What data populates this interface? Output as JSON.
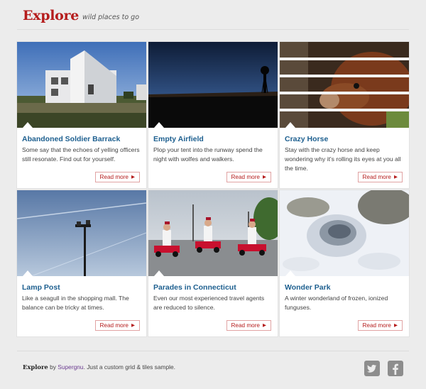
{
  "header": {
    "logo": "Explore",
    "tagline": "wild places to go"
  },
  "cards": [
    {
      "title": "Abandoned Soldier Barrack",
      "text": "Some say that the echoes of yelling officers still resonate. Find out for yourself.",
      "cta": "Read more"
    },
    {
      "title": "Empty Airfield",
      "text": "Plop your tent into the runway spend the night with wolfes and walkers.",
      "cta": "Read more"
    },
    {
      "title": "Crazy Horse",
      "text": "Stay with the crazy horse and keep wondering why it's rolling its eyes at you all the time.",
      "cta": "Read more"
    },
    {
      "title": "Lamp Post",
      "text": "Like a seagull in the shopping mall. The balance can be tricky at times.",
      "cta": "Read more"
    },
    {
      "title": "Parades in Connecticut",
      "text": "Even our most experienced travel agents are reduced to silence.",
      "cta": "Read more"
    },
    {
      "title": "Wonder Park",
      "text": "A winter wonderland of frozen, ionized funguses.",
      "cta": "Read more"
    }
  ],
  "footer": {
    "brand": "Explore",
    "by": "by",
    "author": "Supergnu",
    "suffix": ". Just a custom grid & tiles sample."
  },
  "social": [
    {
      "icon": "twitter-icon"
    },
    {
      "icon": "facebook-icon"
    }
  ],
  "colors": {
    "brand": "#b51c1c",
    "title": "#1d5f8f",
    "background": "#ececec"
  }
}
